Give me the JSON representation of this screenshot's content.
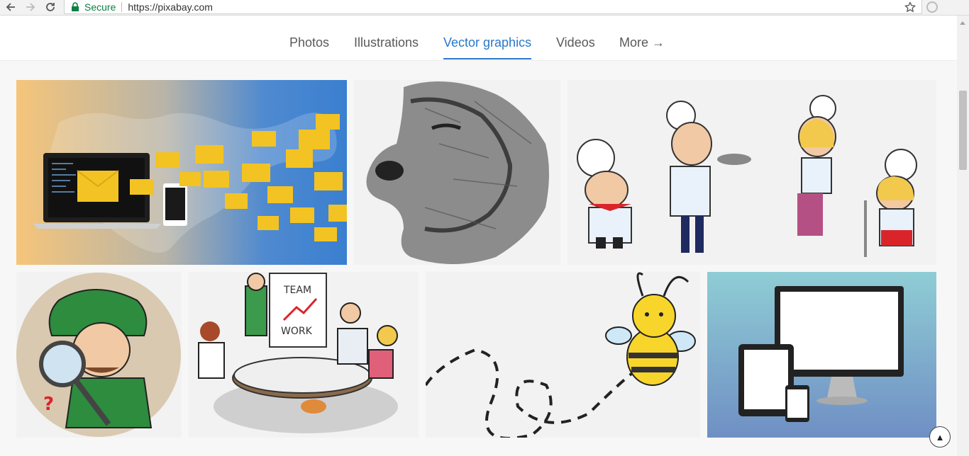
{
  "browser": {
    "secure_label": "Secure",
    "url": "https://pixabay.com"
  },
  "tabs": [
    {
      "label": "Photos"
    },
    {
      "label": "Illustrations"
    },
    {
      "label": "Vector graphics"
    },
    {
      "label": "Videos"
    },
    {
      "label": "More →"
    }
  ],
  "active_tab": "Vector graphics",
  "images": [
    {
      "subject": "email-laptop-world-map"
    },
    {
      "subject": "dog-sketch"
    },
    {
      "subject": "chefs-cartoon"
    },
    {
      "subject": "detective-magnifier"
    },
    {
      "subject": "teamwork-meeting"
    },
    {
      "subject": "bee-dashed-path"
    },
    {
      "subject": "devices-monitor-tablet-phone"
    }
  ],
  "team_board": {
    "line1": "TEAM",
    "line2": "WORK"
  },
  "colors": {
    "accent": "#2a78c8",
    "secure": "#0b8043"
  }
}
